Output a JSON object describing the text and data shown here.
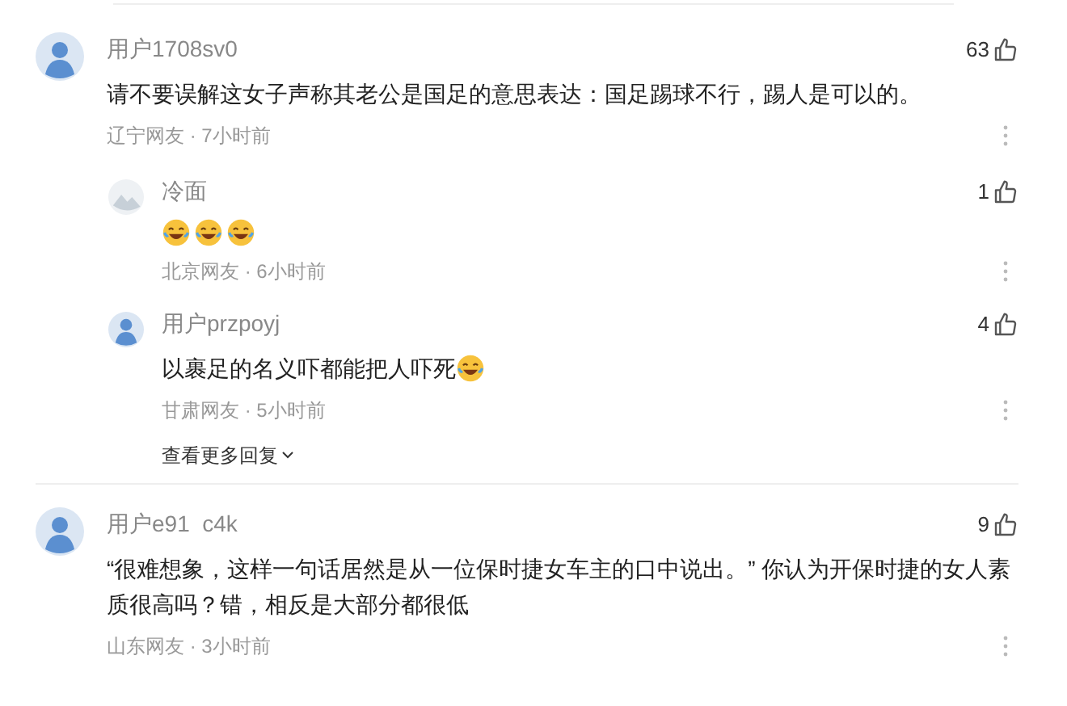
{
  "comments": [
    {
      "user": "用户1708sv0",
      "likes": "63",
      "body": "请不要误解这女子声称其老公是国足的意思表达：国足踢球不行，踢人是可以的。",
      "meta": "辽宁网友 · 7小时前",
      "replies": [
        {
          "user": "冷面",
          "kind": "landscape",
          "likes": "1",
          "emojis": [
            {
              "kind": "laugh"
            },
            {
              "kind": "laugh"
            },
            {
              "kind": "laugh"
            }
          ],
          "meta": "北京网友 · 6小时前"
        },
        {
          "user": "用户przpoyj",
          "kind": "person",
          "likes": "4",
          "body": "以裹足的名义吓都能把人吓死",
          "emojis": [
            {
              "kind": "laugh"
            }
          ],
          "meta": "甘肃网友 · 5小时前"
        }
      ],
      "more": "查看更多回复"
    },
    {
      "user": "用户e91  c4k",
      "likes": "9",
      "body": "“很难想象，这样一句话居然是从一位保时捷女车主的口中说出。” 你认为开保时捷的女人素质很高吗？错，相反是大部分都很低",
      "meta": "山东网友 · 3小时前"
    }
  ]
}
